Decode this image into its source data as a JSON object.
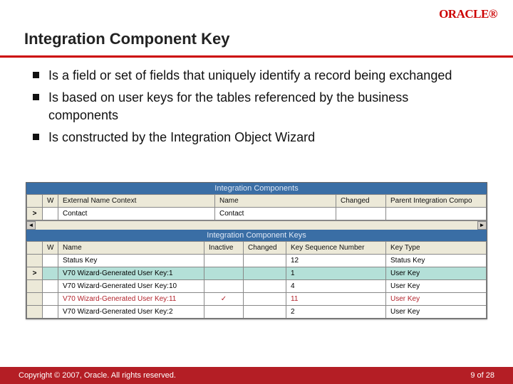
{
  "logo": "ORACLE®",
  "title": "Integration Component Key",
  "bullets": [
    "Is a field or set of fields that uniquely identify a record being exchanged",
    "Is based on user keys for the tables referenced by the business components",
    "Is constructed by the Integration Object Wizard"
  ],
  "shot": {
    "panel1_title": "Integration Components",
    "table1": {
      "headers": [
        "",
        "W",
        "External Name Context",
        "Name",
        "Changed",
        "Parent Integration Compo"
      ],
      "rows": [
        {
          "sel": ">",
          "w": "",
          "ext": "Contact",
          "name": "Contact",
          "changed": "",
          "parent": ""
        }
      ]
    },
    "panel2_title": "Integration Component Keys",
    "table2": {
      "headers": [
        "",
        "W",
        "Name",
        "Inactive",
        "Changed",
        "Key Sequence Number",
        "Key Type"
      ],
      "rows": [
        {
          "sel": "",
          "w": "",
          "name": "Status Key",
          "inactive": "",
          "changed": "",
          "seq": "12",
          "type": "Status Key",
          "cls": ""
        },
        {
          "sel": ">",
          "w": "",
          "name": "V70 Wizard-Generated User Key:1",
          "inactive": "",
          "changed": "",
          "seq": "1",
          "type": "User Key",
          "cls": "selected"
        },
        {
          "sel": "",
          "w": "",
          "name": "V70 Wizard-Generated User Key:10",
          "inactive": "",
          "changed": "",
          "seq": "4",
          "type": "User Key",
          "cls": ""
        },
        {
          "sel": "",
          "w": "",
          "name": "V70 Wizard-Generated User Key:11",
          "inactive": "✓",
          "changed": "",
          "seq": "11",
          "type": "User Key",
          "cls": "flagged"
        },
        {
          "sel": "",
          "w": "",
          "name": "V70 Wizard-Generated User Key:2",
          "inactive": "",
          "changed": "",
          "seq": "2",
          "type": "User Key",
          "cls": ""
        }
      ]
    }
  },
  "footer": {
    "copyright": "Copyright © 2007, Oracle. All rights reserved.",
    "page": "9 of 28"
  }
}
